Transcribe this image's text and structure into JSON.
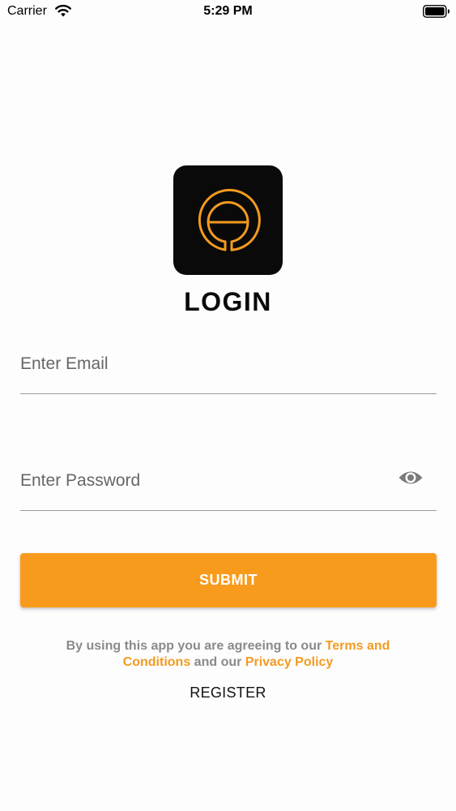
{
  "status_bar": {
    "carrier": "Carrier",
    "time": "5:29 PM",
    "wifi_icon": "wifi-icon",
    "battery_icon": "battery-icon"
  },
  "logo": {
    "icon": "e-logo-icon",
    "background_color": "#0a0a0a",
    "accent_color": "#f39a1f"
  },
  "login": {
    "title": "LOGIN",
    "email": {
      "placeholder": "Enter Email",
      "value": ""
    },
    "password": {
      "placeholder": "Enter Password",
      "value": "",
      "toggle_icon": "eye-icon"
    },
    "submit_label": "SUBMIT",
    "submit_color": "#f89b1c"
  },
  "terms": {
    "prefix": "By using this app you are agreeing to our",
    "terms_link": "Terms and Conditions",
    "middle": "and our",
    "privacy_link": "Privacy Policy",
    "link_color": "#f39a1f"
  },
  "register_label": "REGISTER"
}
